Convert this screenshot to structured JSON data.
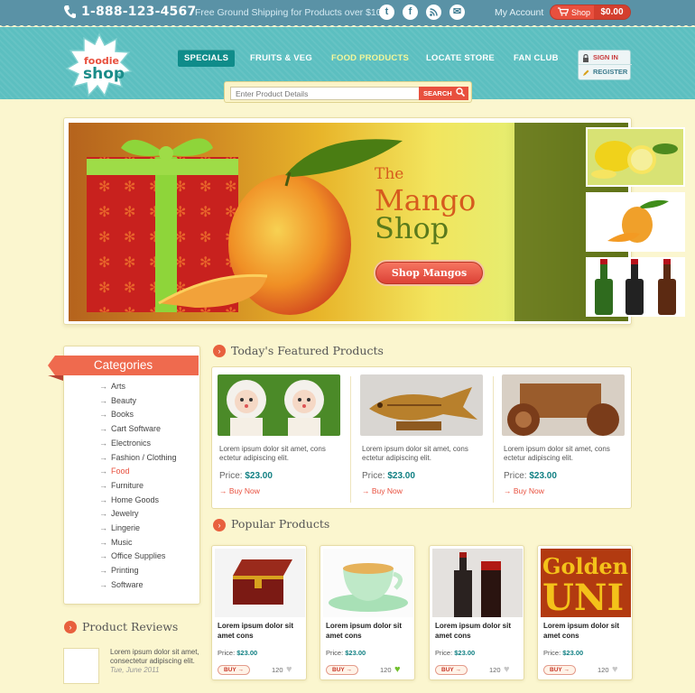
{
  "topbar": {
    "phone": "1-888-123-4567",
    "shipping": "Free Ground Shipping for Products over $100",
    "social": [
      {
        "name": "twitter-icon",
        "glyph": "t"
      },
      {
        "name": "facebook-icon",
        "glyph": "f"
      },
      {
        "name": "rss-icon",
        "glyph": "⌁"
      },
      {
        "name": "mail-icon",
        "glyph": "✉"
      }
    ],
    "my_account": "My Account",
    "shop_label": "Shop",
    "cart_total": "$0.00"
  },
  "header": {
    "logo_line1": "foodie",
    "logo_line2": "shop",
    "nav": [
      "SPECIALS",
      "FRUITS & VEG",
      "FOOD PRODUCTS",
      "LOCATE STORE",
      "FAN CLUB"
    ],
    "sign_in": "SIGN IN",
    "register": "REGISTER",
    "search_placeholder": "Enter Product Details",
    "search_button": "SEARCH"
  },
  "hero": {
    "title_line1": "The",
    "title_line2": "Mango",
    "title_line3": "Shop",
    "button": "Shop Mangos"
  },
  "categories": {
    "title": "Categories",
    "items": [
      "Arts",
      "Beauty",
      "Books",
      "Cart Software",
      "Electronics",
      "Fashion / Clothing",
      "Food",
      "Furniture",
      "Home Goods",
      "Jewelry",
      "Lingerie",
      "Music",
      "Office Supplies",
      "Printing",
      "Software"
    ],
    "active": "Food"
  },
  "featured": {
    "title": "Today's Featured Products",
    "products": [
      {
        "desc": "Lorem ipsum dolor sit amet, cons ectetur adipiscing elit.",
        "price_label": "Price:",
        "price": "$23.00",
        "buy": "Buy Now"
      },
      {
        "desc": "Lorem ipsum dolor sit amet, cons ectetur adipiscing elit.",
        "price_label": "Price:",
        "price": "$23.00",
        "buy": "Buy Now"
      },
      {
        "desc": "Lorem ipsum dolor sit amet, cons ectetur adipiscing elit.",
        "price_label": "Price:",
        "price": "$23.00",
        "buy": "Buy Now"
      }
    ]
  },
  "popular": {
    "title": "Popular Products",
    "products": [
      {
        "name": "Lorem ipsum dolor sit amet cons",
        "price_label": "Price:",
        "price": "$23.00",
        "buy": "BUY",
        "count": "120",
        "liked": false
      },
      {
        "name": "Lorem ipsum dolor sit amet cons",
        "price_label": "Price:",
        "price": "$23.00",
        "buy": "BUY",
        "count": "120",
        "liked": true
      },
      {
        "name": "Lorem ipsum dolor sit amet cons",
        "price_label": "Price:",
        "price": "$23.00",
        "buy": "BUY",
        "count": "120",
        "liked": false
      },
      {
        "name": "Lorem ipsum dolor sit amet cons",
        "price_label": "Price:",
        "price": "$23.00",
        "buy": "BUY",
        "count": "120",
        "liked": false
      }
    ],
    "golden_text": "Golden",
    "golden_text2": "UNI"
  },
  "reviews": {
    "title": "Product Reviews",
    "text": "Lorem ipsum dolor sit amet, consectetur adipiscing elit.",
    "date": "Tue, June 2011"
  },
  "colors": {
    "accent": "#e8503e",
    "teal": "#5cbfc0",
    "background": "#fbf6cf",
    "price": "#0f7f82"
  }
}
